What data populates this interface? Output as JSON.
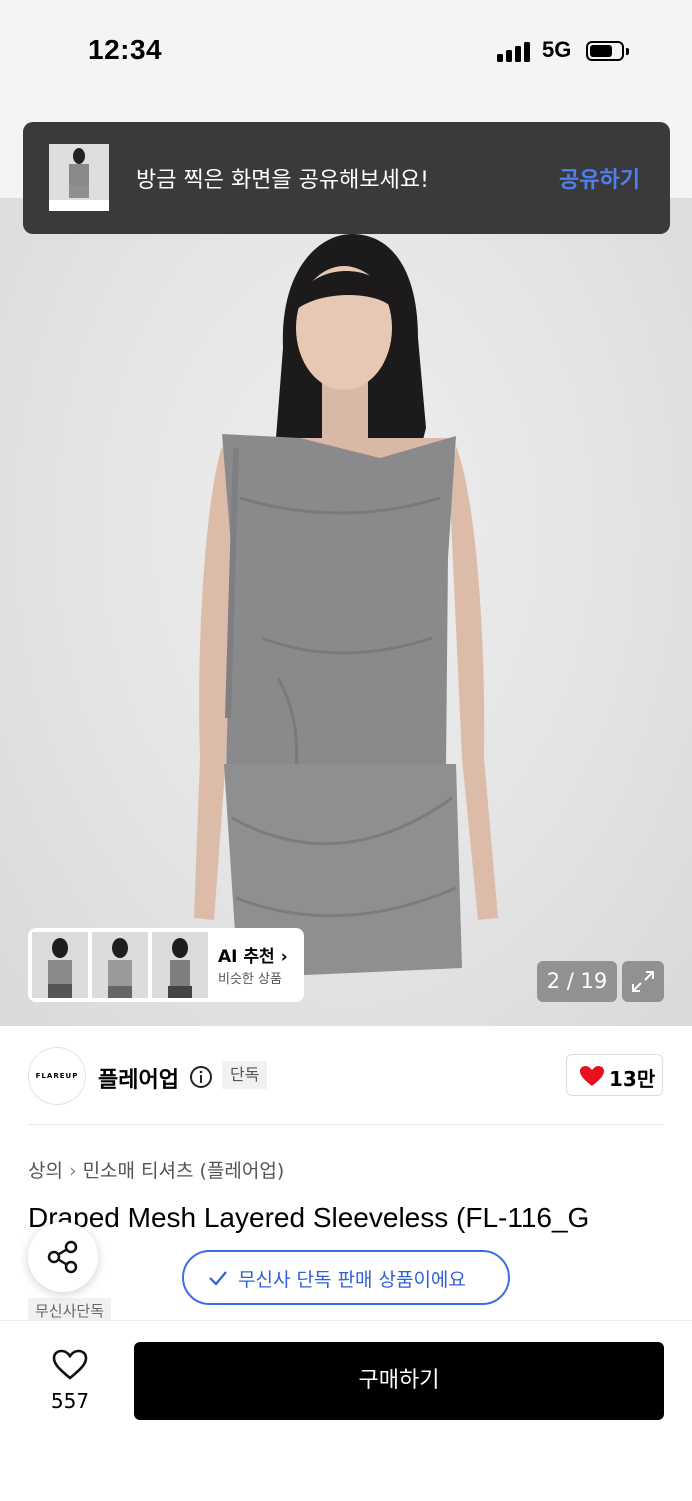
{
  "status_bar": {
    "time": "12:34",
    "network": "5G"
  },
  "toast": {
    "message": "방금 찍은 화면을 공유해보세요!",
    "action_label": "공유하기"
  },
  "gallery": {
    "current": "2",
    "total": "19",
    "counter": "2 / 19"
  },
  "ai_recommend": {
    "title": "AI 추천",
    "subtitle": "비슷한 상품"
  },
  "brand": {
    "logo_text": "FLAREUP",
    "name": "플레어업",
    "badge": "단독",
    "like_count": "13만"
  },
  "breadcrumb": {
    "category": "상의",
    "subcategory": "민소매 티셔츠 (플레어업)"
  },
  "product": {
    "title": "Draped Mesh Layered Sleeveless (FL-116_G",
    "tag": "무신사단독"
  },
  "exclusive_notice": "무신사 단독 판매 상품이에요",
  "bottom_bar": {
    "wish_count": "557",
    "buy_label": "구매하기"
  },
  "colors": {
    "accent": "#3b6fe6",
    "heart": "#e8101b",
    "toast_bg": "#3a3a3a",
    "buy_bg": "#000000"
  }
}
